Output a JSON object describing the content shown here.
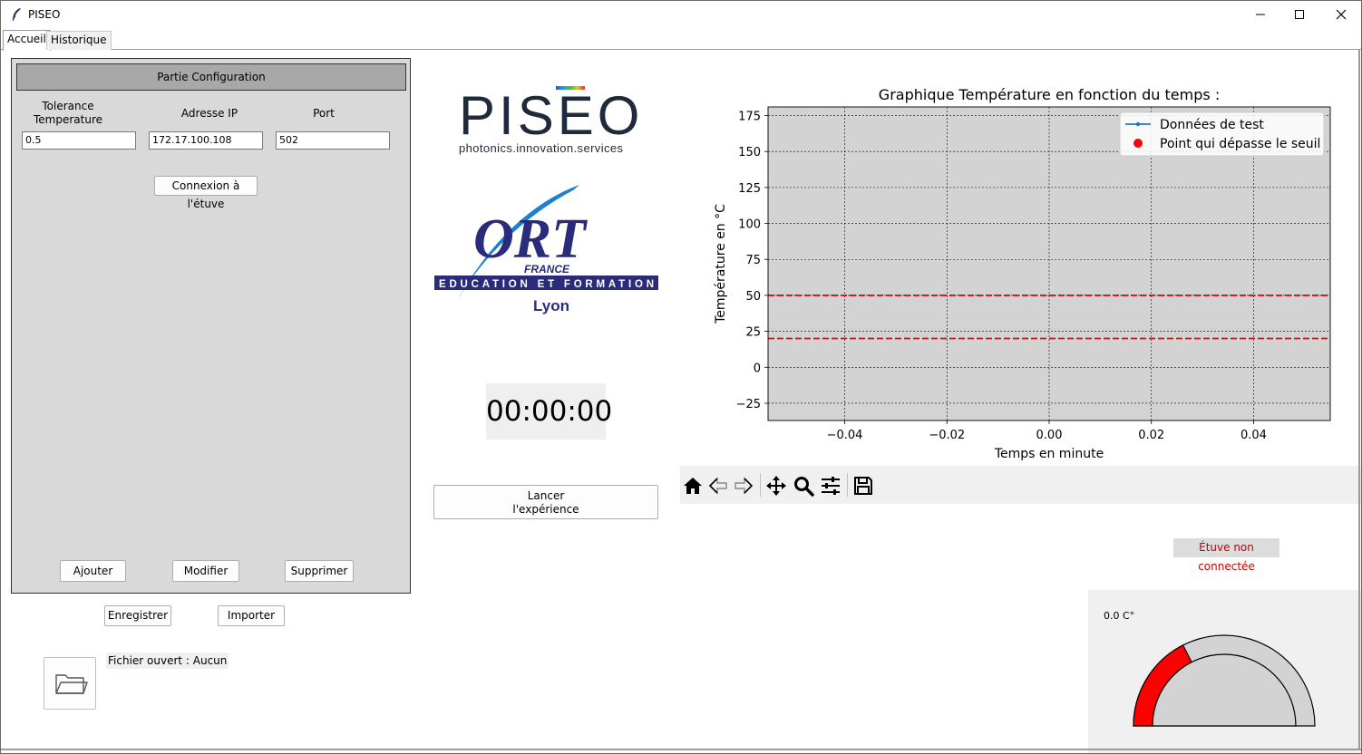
{
  "window": {
    "title": "PISEO"
  },
  "tabs": [
    {
      "label": "Accueil"
    },
    {
      "label": "Historique"
    }
  ],
  "config": {
    "header": "Partie Configuration",
    "tolerance_label": "Tolerance\nTemperature",
    "ip_label": "Adresse IP",
    "port_label": "Port",
    "tolerance_value": "0.5",
    "ip_value": "172.17.100.108",
    "port_value": "502",
    "connect_button": "Connexion à l'étuve",
    "add_button": "Ajouter",
    "modify_button": "Modifier",
    "delete_button": "Supprimer"
  },
  "file": {
    "save_button": "Enregistrer",
    "import_button": "Importer",
    "opened_label": "Fichier ouvert : Aucun"
  },
  "logos": {
    "piseo_name": "PISEO",
    "piseo_tagline": "photonics.innovation.services",
    "ort_name": "ORT",
    "ort_country": "FRANCE",
    "ort_banner": "EDUCATION ET FORMATION",
    "ort_city": "Lyon"
  },
  "timer": {
    "value": "00:00:00"
  },
  "experiment": {
    "launch_button": "Lancer\nl'expérience"
  },
  "status": {
    "oven": "Étuve non connectée",
    "color": "#cc0000"
  },
  "gauge": {
    "value_label": "0.0 C°",
    "fill_color": "#ff0000",
    "fill_fraction": 0.35
  },
  "chart_data": {
    "type": "line",
    "title": "Graphique Température en fonction du temps :",
    "xlabel": "Temps en minute",
    "ylabel": "Température en °C",
    "xlim": [
      -0.055,
      0.055
    ],
    "ylim": [
      -37,
      181
    ],
    "x_ticks": [
      -0.04,
      -0.02,
      0.0,
      0.02,
      0.04
    ],
    "x_tick_labels": [
      "−0.04",
      "−0.02",
      "0.00",
      "0.02",
      "0.04"
    ],
    "y_ticks": [
      -25,
      0,
      25,
      50,
      75,
      100,
      125,
      150,
      175
    ],
    "y_tick_labels": [
      "−25",
      "0",
      "25",
      "50",
      "75",
      "100",
      "125",
      "150",
      "175"
    ],
    "grid": true,
    "legend_position": "top-right",
    "background": "#d3d3d3",
    "series": [
      {
        "name": "Données de test",
        "color": "#1f77b4",
        "x": [],
        "y": []
      },
      {
        "name": "Point qui dépasse le seuil",
        "color": "#ff0000",
        "x": [],
        "y": []
      }
    ],
    "threshold_lines": [
      {
        "y": 50,
        "color": "#ff0000",
        "style": "dashed"
      },
      {
        "y": 20,
        "color": "#ff0000",
        "style": "dashed"
      }
    ]
  },
  "toolbar": {
    "icons": [
      "home-icon",
      "back-icon",
      "forward-icon",
      "pan-icon",
      "zoom-icon",
      "configure-subplots-icon",
      "save-icon"
    ]
  }
}
